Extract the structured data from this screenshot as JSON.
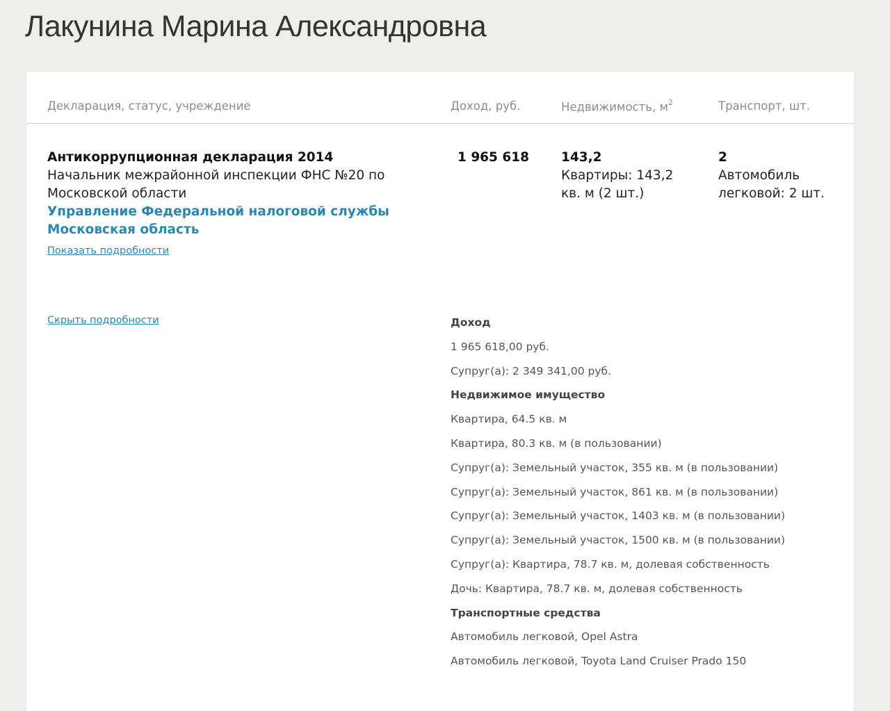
{
  "person": {
    "name": "Лакунина Марина Александровна"
  },
  "table": {
    "headers": {
      "declaration": "Декларация, статус, учреждение",
      "income": "Доход, руб.",
      "realty": "Недвижимость, м",
      "realty_sup": "2",
      "transport": "Транспорт, шт."
    }
  },
  "declaration": {
    "title": "Антикоррупционная декларация 2014",
    "position": "Начальник межрайонной инспекции ФНС №20 по Московской области",
    "organization": "Управление Федеральной налоговой службы Московская область",
    "income": "1 965 618",
    "realty_total": "143,2",
    "realty_desc": "Квартиры: 143,2 кв. м (2 шт.)",
    "transport_count": "2",
    "transport_desc": "Автомобиль легковой: 2 шт.",
    "show_details": "Показать подробности",
    "hide_details": "Скрыть подробности"
  },
  "details": {
    "income_heading": "Доход",
    "income_items": [
      "1 965 618,00 руб.",
      "Супруг(а): 2 349 341,00 руб."
    ],
    "realty_heading": "Недвижимое имущество",
    "realty_items": [
      "Квартира, 64.5 кв. м",
      "Квартира, 80.3 кв. м (в пользовании)",
      "Супруг(а): Земельный участок, 355 кв. м (в пользовании)",
      "Супруг(а): Земельный участок, 861 кв. м (в пользовании)",
      "Супруг(а): Земельный участок, 1403 кв. м (в пользовании)",
      "Супруг(а): Земельный участок, 1500 кв. м (в пользовании)",
      "Супруг(а): Квартира, 78.7 кв. м, долевая собственность",
      "Дочь: Квартира, 78.7 кв. м, долевая собственность"
    ],
    "transport_heading": "Транспортные средства",
    "transport_items": [
      "Автомобиль легковой, Opel Astra",
      "Автомобиль легковой, Toyota Land Cruiser Prado 150"
    ]
  },
  "colors": {
    "page_background": "#eeeeea",
    "card_background": "#ffffff",
    "link": "#2b87ae",
    "header_text": "#8c8c8c"
  }
}
